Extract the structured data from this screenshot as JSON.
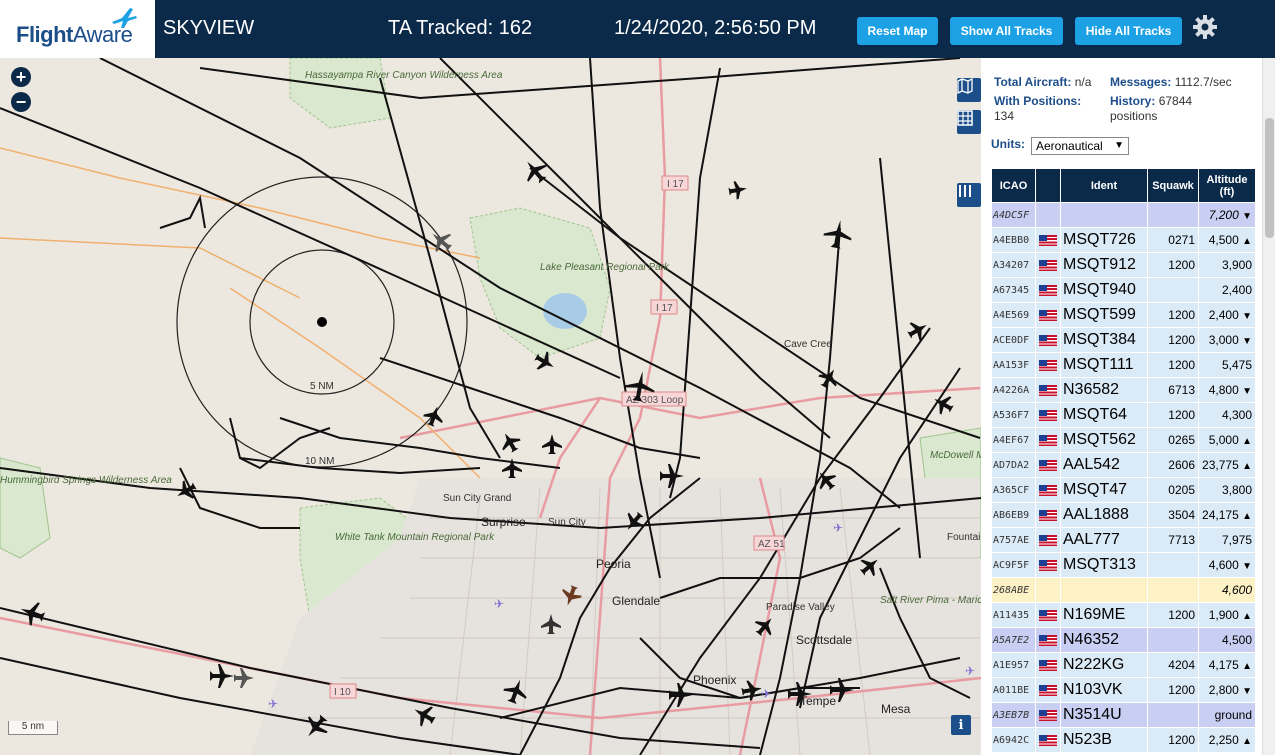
{
  "header": {
    "logo_flight": "Flight",
    "logo_aware": "Aware",
    "app_title": "SKYVIEW",
    "tracked": "TA Tracked: 162",
    "timestamp": "1/24/2020, 2:56:50 PM",
    "buttons": {
      "reset": "Reset Map",
      "show_all": "Show All Tracks",
      "hide_all": "Hide All Tracks"
    }
  },
  "map": {
    "labels": {
      "hassayampa": "Hassayampa River Canyon Wilderness Area",
      "lake_pleasant": "Lake Pleasant Regional Park",
      "cave_creek": "Cave Cree",
      "mcdowell": "McDowell Mountain Regional Park",
      "fountain": "Fountai",
      "hummingbird": "Hummingbird Springs Wilderness Area",
      "white_tank": "White Tank Mountain Regional Park",
      "sun_city_grand": "Sun City Grand",
      "surprise": "Surprise",
      "sun_city": "Sun City",
      "peoria": "Peoria",
      "glendale": "Glendale",
      "paradise_valley": "Paradise Valley",
      "scottsdale": "Scottsdale",
      "salt_river": "Salt River Pima - Maricopa Indian Community",
      "phoenix": "Phoenix",
      "tempe": "Tempe",
      "mesa": "Mesa",
      "range_5": "5 NM",
      "range_10": "10 NM",
      "i17_a": "I 17",
      "i17_b": "I 17",
      "az303": "AZ 303 Loop",
      "az51": "AZ 51",
      "i10": "I 10"
    },
    "scale_label": "5 nm",
    "zoom_in": "+",
    "zoom_out": "−"
  },
  "panel": {
    "total_aircraft_label": "Total Aircraft:",
    "total_aircraft_value": "n/a",
    "messages_label": "Messages:",
    "messages_value": "1112.7/sec",
    "positions_label": "With Positions:",
    "positions_value": "134",
    "history_label": "History:",
    "history_value": "67844 positions",
    "units_label": "Units:",
    "units_value": "Aeronautical",
    "columns": [
      "ICAO",
      "",
      "Ident",
      "Squawk",
      "Altitude (ft)"
    ],
    "rows": [
      {
        "icao": "A4DC5F",
        "ident": "",
        "squawk": "",
        "alt": "7,200",
        "trend": "▼",
        "style": "sel"
      },
      {
        "icao": "A4EBB0",
        "ident": "MSQT726",
        "squawk": "0271",
        "alt": "4,500",
        "trend": "▲",
        "style": ""
      },
      {
        "icao": "A34207",
        "ident": "MSQT912",
        "squawk": "1200",
        "alt": "3,900",
        "trend": "",
        "style": ""
      },
      {
        "icao": "A67345",
        "ident": "MSQT940",
        "squawk": "",
        "alt": "2,400",
        "trend": "",
        "style": ""
      },
      {
        "icao": "A4E569",
        "ident": "MSQT599",
        "squawk": "1200",
        "alt": "2,400",
        "trend": "▼",
        "style": ""
      },
      {
        "icao": "ACE0DF",
        "ident": "MSQT384",
        "squawk": "1200",
        "alt": "3,000",
        "trend": "▼",
        "style": ""
      },
      {
        "icao": "AA153F",
        "ident": "MSQT111",
        "squawk": "1200",
        "alt": "5,475",
        "trend": "",
        "style": ""
      },
      {
        "icao": "A4226A",
        "ident": "N36582",
        "squawk": "6713",
        "alt": "4,800",
        "trend": "▼",
        "style": ""
      },
      {
        "icao": "A536F7",
        "ident": "MSQT64",
        "squawk": "1200",
        "alt": "4,300",
        "trend": "",
        "style": ""
      },
      {
        "icao": "A4EF67",
        "ident": "MSQT562",
        "squawk": "0265",
        "alt": "5,000",
        "trend": "▲",
        "style": ""
      },
      {
        "icao": "AD7DA2",
        "ident": "AAL542",
        "squawk": "2606",
        "alt": "23,775",
        "trend": "▲",
        "style": ""
      },
      {
        "icao": "A365CF",
        "ident": "MSQT47",
        "squawk": "0205",
        "alt": "3,800",
        "trend": "",
        "style": ""
      },
      {
        "icao": "AB6EB9",
        "ident": "AAL1888",
        "squawk": "3504",
        "alt": "24,175",
        "trend": "▲",
        "style": ""
      },
      {
        "icao": "A757AE",
        "ident": "AAL777",
        "squawk": "7713",
        "alt": "7,975",
        "trend": "",
        "style": ""
      },
      {
        "icao": "AC9F5F",
        "ident": "MSQT313",
        "squawk": "",
        "alt": "4,600",
        "trend": "▼",
        "style": ""
      },
      {
        "icao": "268ABE",
        "ident": "",
        "squawk": "",
        "alt": "4,600",
        "trend": "",
        "style": "hl"
      },
      {
        "icao": "A11435",
        "ident": "N169ME",
        "squawk": "1200",
        "alt": "1,900",
        "trend": "▲",
        "style": ""
      },
      {
        "icao": "A5A7E2",
        "ident": "N46352",
        "squawk": "",
        "alt": "4,500",
        "trend": "",
        "style": "sel"
      },
      {
        "icao": "A1E957",
        "ident": "N222KG",
        "squawk": "4204",
        "alt": "4,175",
        "trend": "▲",
        "style": ""
      },
      {
        "icao": "A011BE",
        "ident": "N103VK",
        "squawk": "1200",
        "alt": "2,800",
        "trend": "▼",
        "style": ""
      },
      {
        "icao": "A3EB7B",
        "ident": "N3514U",
        "squawk": "",
        "alt": "ground",
        "trend": "",
        "style": "sel"
      },
      {
        "icao": "A6942C",
        "ident": "N523B",
        "squawk": "1200",
        "alt": "2,250",
        "trend": "▲",
        "style": ""
      }
    ]
  },
  "colors": {
    "header_bg": "#0b2a4a",
    "button_bg": "#1da1e5",
    "map_bg": "#ede8df",
    "row_bg": "#daeaf7",
    "row_selected": "#c8cff2",
    "row_highlight": "#fdf2c6"
  }
}
